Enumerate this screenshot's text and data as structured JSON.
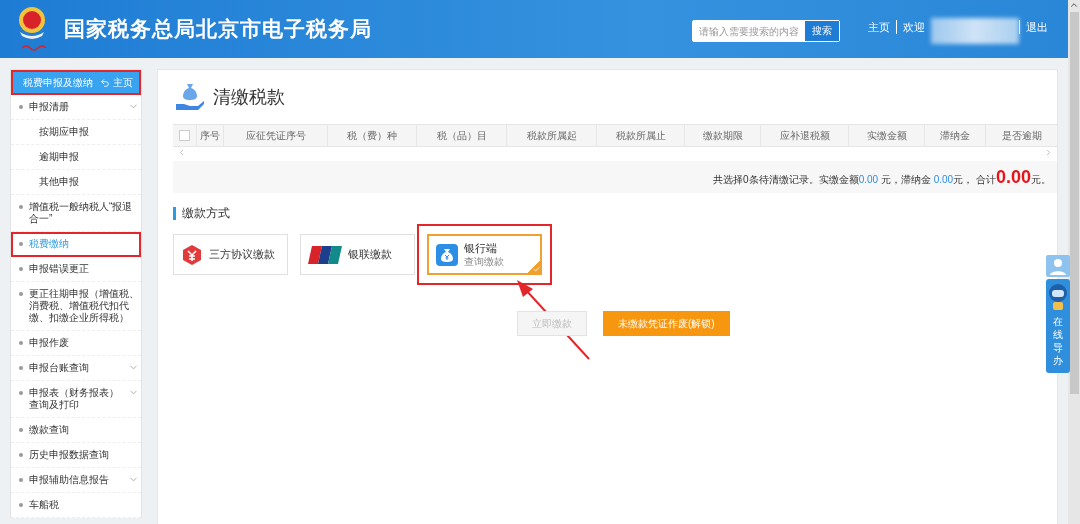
{
  "header": {
    "title": "国家税务总局北京市电子税务局",
    "search": {
      "placeholder": "请输入需要搜索的内容",
      "button": "搜索"
    },
    "links": [
      "主页",
      "欢迎"
    ],
    "logout": "退出"
  },
  "sidebar": {
    "title": "税费申报及缴纳",
    "home": "主页",
    "annotated": true,
    "items": [
      {
        "label": "申报清册",
        "expandable": true,
        "selected": false,
        "annotated": false,
        "children": [
          {
            "label": "按期应申报",
            "selected": false
          },
          {
            "label": "逾期申报",
            "selected": false
          },
          {
            "label": "其他申报",
            "selected": false
          }
        ]
      },
      {
        "label": "增值税一般纳税人“报退合一”",
        "expandable": false,
        "selected": false,
        "annotated": false
      },
      {
        "label": "税费缴纳",
        "expandable": false,
        "selected": true,
        "annotated": true
      },
      {
        "label": "申报错误更正",
        "expandable": false,
        "selected": false,
        "annotated": false
      },
      {
        "label": "更正往期申报（增值税、消费税、增值税代扣代缴、扣缴企业所得税）",
        "expandable": false,
        "selected": false,
        "annotated": false
      },
      {
        "label": "申报作废",
        "expandable": false,
        "selected": false,
        "annotated": false
      },
      {
        "label": "申报台账查询",
        "expandable": true,
        "selected": false,
        "annotated": false
      },
      {
        "label": "申报表（财务报表）查询及打印",
        "expandable": true,
        "selected": false,
        "annotated": false
      },
      {
        "label": "缴款查询",
        "expandable": false,
        "selected": false,
        "annotated": false
      },
      {
        "label": "历史申报数据查询",
        "expandable": false,
        "selected": false,
        "annotated": false
      },
      {
        "label": "申报辅助信息报告",
        "expandable": true,
        "selected": false,
        "annotated": false
      },
      {
        "label": "车船税",
        "expandable": false,
        "selected": false,
        "annotated": false
      }
    ]
  },
  "main": {
    "title": "清缴税款",
    "table": {
      "select_all": {
        "checked": false
      },
      "columns": [
        "序号",
        "应征凭证序号",
        "税（费）种",
        "税（品）目",
        "税款所属起",
        "税款所属止",
        "缴款期限",
        "应补退税额",
        "实缴金额",
        "滞纳金",
        "是否逾期"
      ]
    },
    "summary": [
      {
        "kind": "text",
        "text": "共选择0条待清缴记录。实缴金额"
      },
      {
        "kind": "amount",
        "text": "0.00"
      },
      {
        "kind": "text",
        "text": " 元，滞纳金 "
      },
      {
        "kind": "amount",
        "text": "0.00"
      },
      {
        "kind": "text",
        "text": "元， 合计"
      },
      {
        "kind": "total",
        "text": "0.00"
      },
      {
        "kind": "text",
        "text": "元。"
      }
    ],
    "payment": {
      "title": "缴款方式",
      "options": [
        {
          "kind": "agreement",
          "label": "三方协议缴款",
          "selected": false,
          "annotated": false
        },
        {
          "kind": "unionpay",
          "label": "银联缴款",
          "selected": false,
          "annotated": false
        },
        {
          "kind": "bank",
          "label": "银行端",
          "sublabel": "查询缴款",
          "selected": true,
          "annotated": true
        }
      ]
    },
    "buttons": [
      {
        "label": "立即缴款",
        "disabled": true
      },
      {
        "label": "未缴款凭证作废(解锁)",
        "disabled": false
      }
    ]
  },
  "helper": {
    "label": "在线导办"
  }
}
